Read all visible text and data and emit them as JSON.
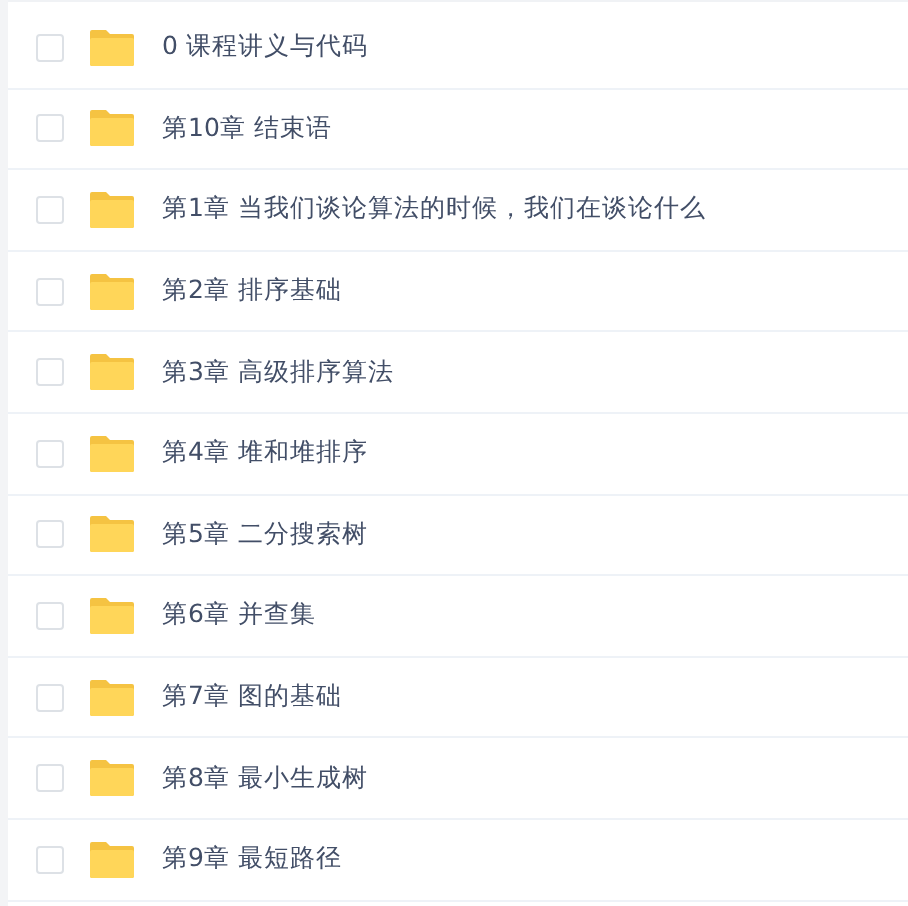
{
  "files": [
    {
      "name": "0 课程讲义与代码",
      "checked": false
    },
    {
      "name": "第10章 结束语",
      "checked": false
    },
    {
      "name": "第1章 当我们谈论算法的时候，我们在谈论什么",
      "checked": false
    },
    {
      "name": "第2章 排序基础",
      "checked": false
    },
    {
      "name": "第3章 高级排序算法",
      "checked": false
    },
    {
      "name": "第4章 堆和堆排序",
      "checked": false
    },
    {
      "name": "第5章 二分搜索树",
      "checked": false
    },
    {
      "name": "第6章 并查集",
      "checked": false
    },
    {
      "name": "第7章 图的基础",
      "checked": false
    },
    {
      "name": "第8章 最小生成树",
      "checked": false
    },
    {
      "name": "第9章 最短路径",
      "checked": false
    }
  ]
}
